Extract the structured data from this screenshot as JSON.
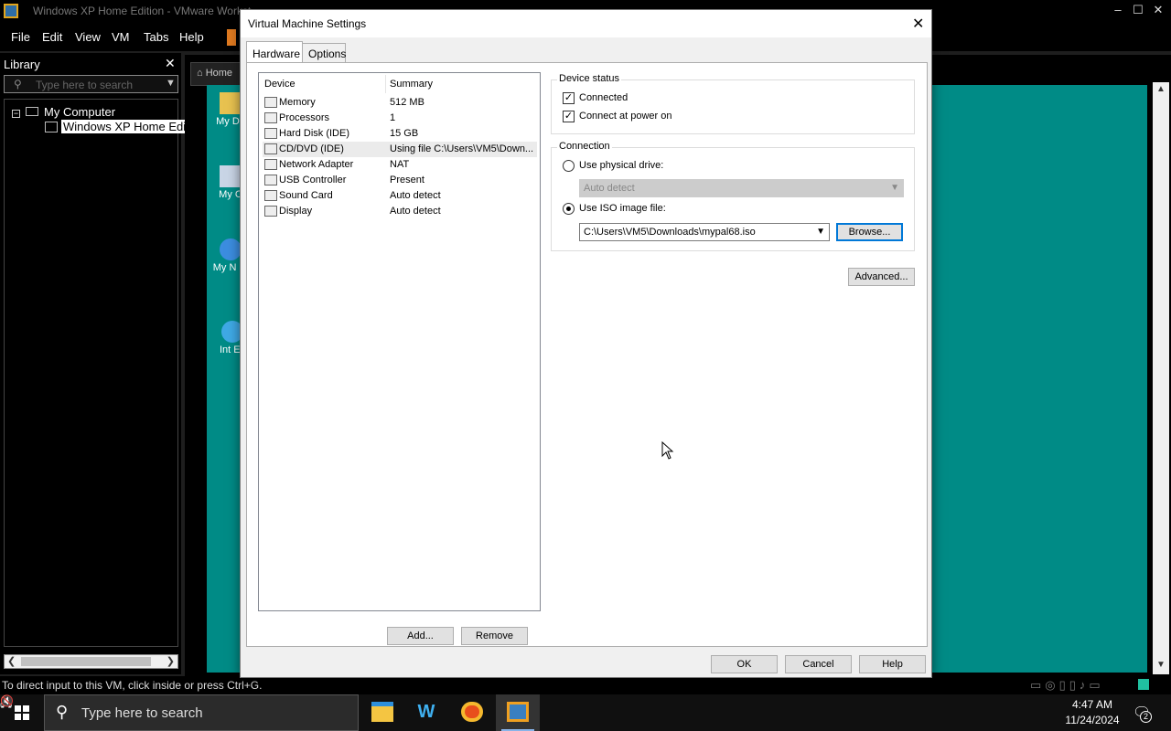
{
  "vmware": {
    "title": "Windows XP Home Edition - VMware Workst...",
    "menu": [
      "File",
      "Edit",
      "View",
      "VM",
      "Tabs",
      "Help"
    ],
    "window_controls": [
      "–",
      "☐",
      "✕"
    ]
  },
  "library": {
    "title": "Library",
    "close": "✕",
    "search_placeholder": "Type here to search",
    "tree_root": "My Computer",
    "tree_vm": "Windows XP Home Edit"
  },
  "vm_tab": {
    "home_label": "Home"
  },
  "desktop_icons": [
    "My Do",
    "My C",
    "My N Pl",
    "Int Ex"
  ],
  "status_message": "To direct input to this VM, click inside or press Ctrl+G.",
  "dialog": {
    "title": "Virtual Machine Settings",
    "tabs": [
      "Hardware",
      "Options"
    ],
    "columns": {
      "device": "Device",
      "summary": "Summary"
    },
    "devices": [
      {
        "name": "Memory",
        "summary": "512 MB",
        "icon": "memory-icon"
      },
      {
        "name": "Processors",
        "summary": "1",
        "icon": "processor-icon"
      },
      {
        "name": "Hard Disk (IDE)",
        "summary": "15 GB",
        "icon": "hard-disk-icon"
      },
      {
        "name": "CD/DVD (IDE)",
        "summary": "Using file C:\\Users\\VM5\\Down...",
        "icon": "cd-dvd-icon"
      },
      {
        "name": "Network Adapter",
        "summary": "NAT",
        "icon": "network-adapter-icon"
      },
      {
        "name": "USB Controller",
        "summary": "Present",
        "icon": "usb-icon"
      },
      {
        "name": "Sound Card",
        "summary": "Auto detect",
        "icon": "sound-card-icon"
      },
      {
        "name": "Display",
        "summary": "Auto detect",
        "icon": "display-icon"
      }
    ],
    "selected_index": 3,
    "add_label": "Add...",
    "remove_label": "Remove",
    "device_status": {
      "label": "Device status",
      "connected": "Connected",
      "connect_at_power_on": "Connect at power on"
    },
    "connection": {
      "label": "Connection",
      "physical": "Use physical drive:",
      "physical_value": "Auto detect",
      "iso": "Use ISO image file:",
      "iso_value": "C:\\Users\\VM5\\Downloads\\mypal68.iso",
      "browse": "Browse..."
    },
    "advanced_label": "Advanced...",
    "ok_label": "OK",
    "cancel_label": "Cancel",
    "help_label": "Help"
  },
  "taskbar": {
    "search_placeholder": "Type here to search",
    "time": "4:47 AM",
    "date": "11/24/2024",
    "notification_count": "2"
  }
}
